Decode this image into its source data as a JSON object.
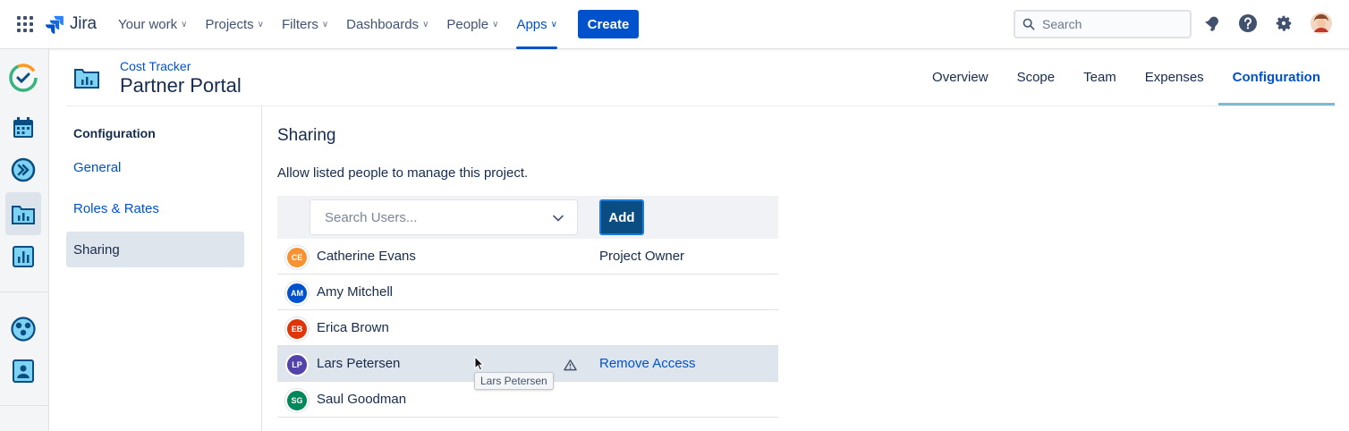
{
  "topbar": {
    "app_name": "Jira",
    "nav": [
      {
        "label": "Your work"
      },
      {
        "label": "Projects"
      },
      {
        "label": "Filters"
      },
      {
        "label": "Dashboards"
      },
      {
        "label": "People"
      },
      {
        "label": "Apps"
      }
    ],
    "active_nav": "Apps",
    "create_label": "Create",
    "search_placeholder": "Search",
    "accent": "#0052cc"
  },
  "project": {
    "breadcrumb": "Cost Tracker",
    "title": "Partner Portal",
    "tabs": [
      {
        "label": "Overview"
      },
      {
        "label": "Scope"
      },
      {
        "label": "Team"
      },
      {
        "label": "Expenses"
      },
      {
        "label": "Configuration"
      }
    ],
    "active_tab": "Configuration"
  },
  "config_nav": {
    "title": "Configuration",
    "items": [
      {
        "label": "General"
      },
      {
        "label": "Roles & Rates"
      },
      {
        "label": "Sharing"
      }
    ],
    "active_item": "Sharing"
  },
  "sharing": {
    "title": "Sharing",
    "description": "Allow listed people to manage this project.",
    "search_placeholder": "Search Users...",
    "add_label": "Add",
    "users": [
      {
        "initials": "CE",
        "name": "Catherine Evans",
        "color": "#f79232",
        "role": "Project Owner",
        "action": ""
      },
      {
        "initials": "AM",
        "name": "Amy Mitchell",
        "color": "#0052cc",
        "role": "",
        "action": ""
      },
      {
        "initials": "EB",
        "name": "Erica Brown",
        "color": "#de350b",
        "role": "",
        "action": ""
      },
      {
        "initials": "LP",
        "name": "Lars Petersen",
        "color": "#5243aa",
        "role": "",
        "action": "Remove Access"
      },
      {
        "initials": "SG",
        "name": "Saul Goodman",
        "color": "#00875a",
        "role": "",
        "action": ""
      }
    ],
    "tooltip": "Lars Petersen"
  }
}
